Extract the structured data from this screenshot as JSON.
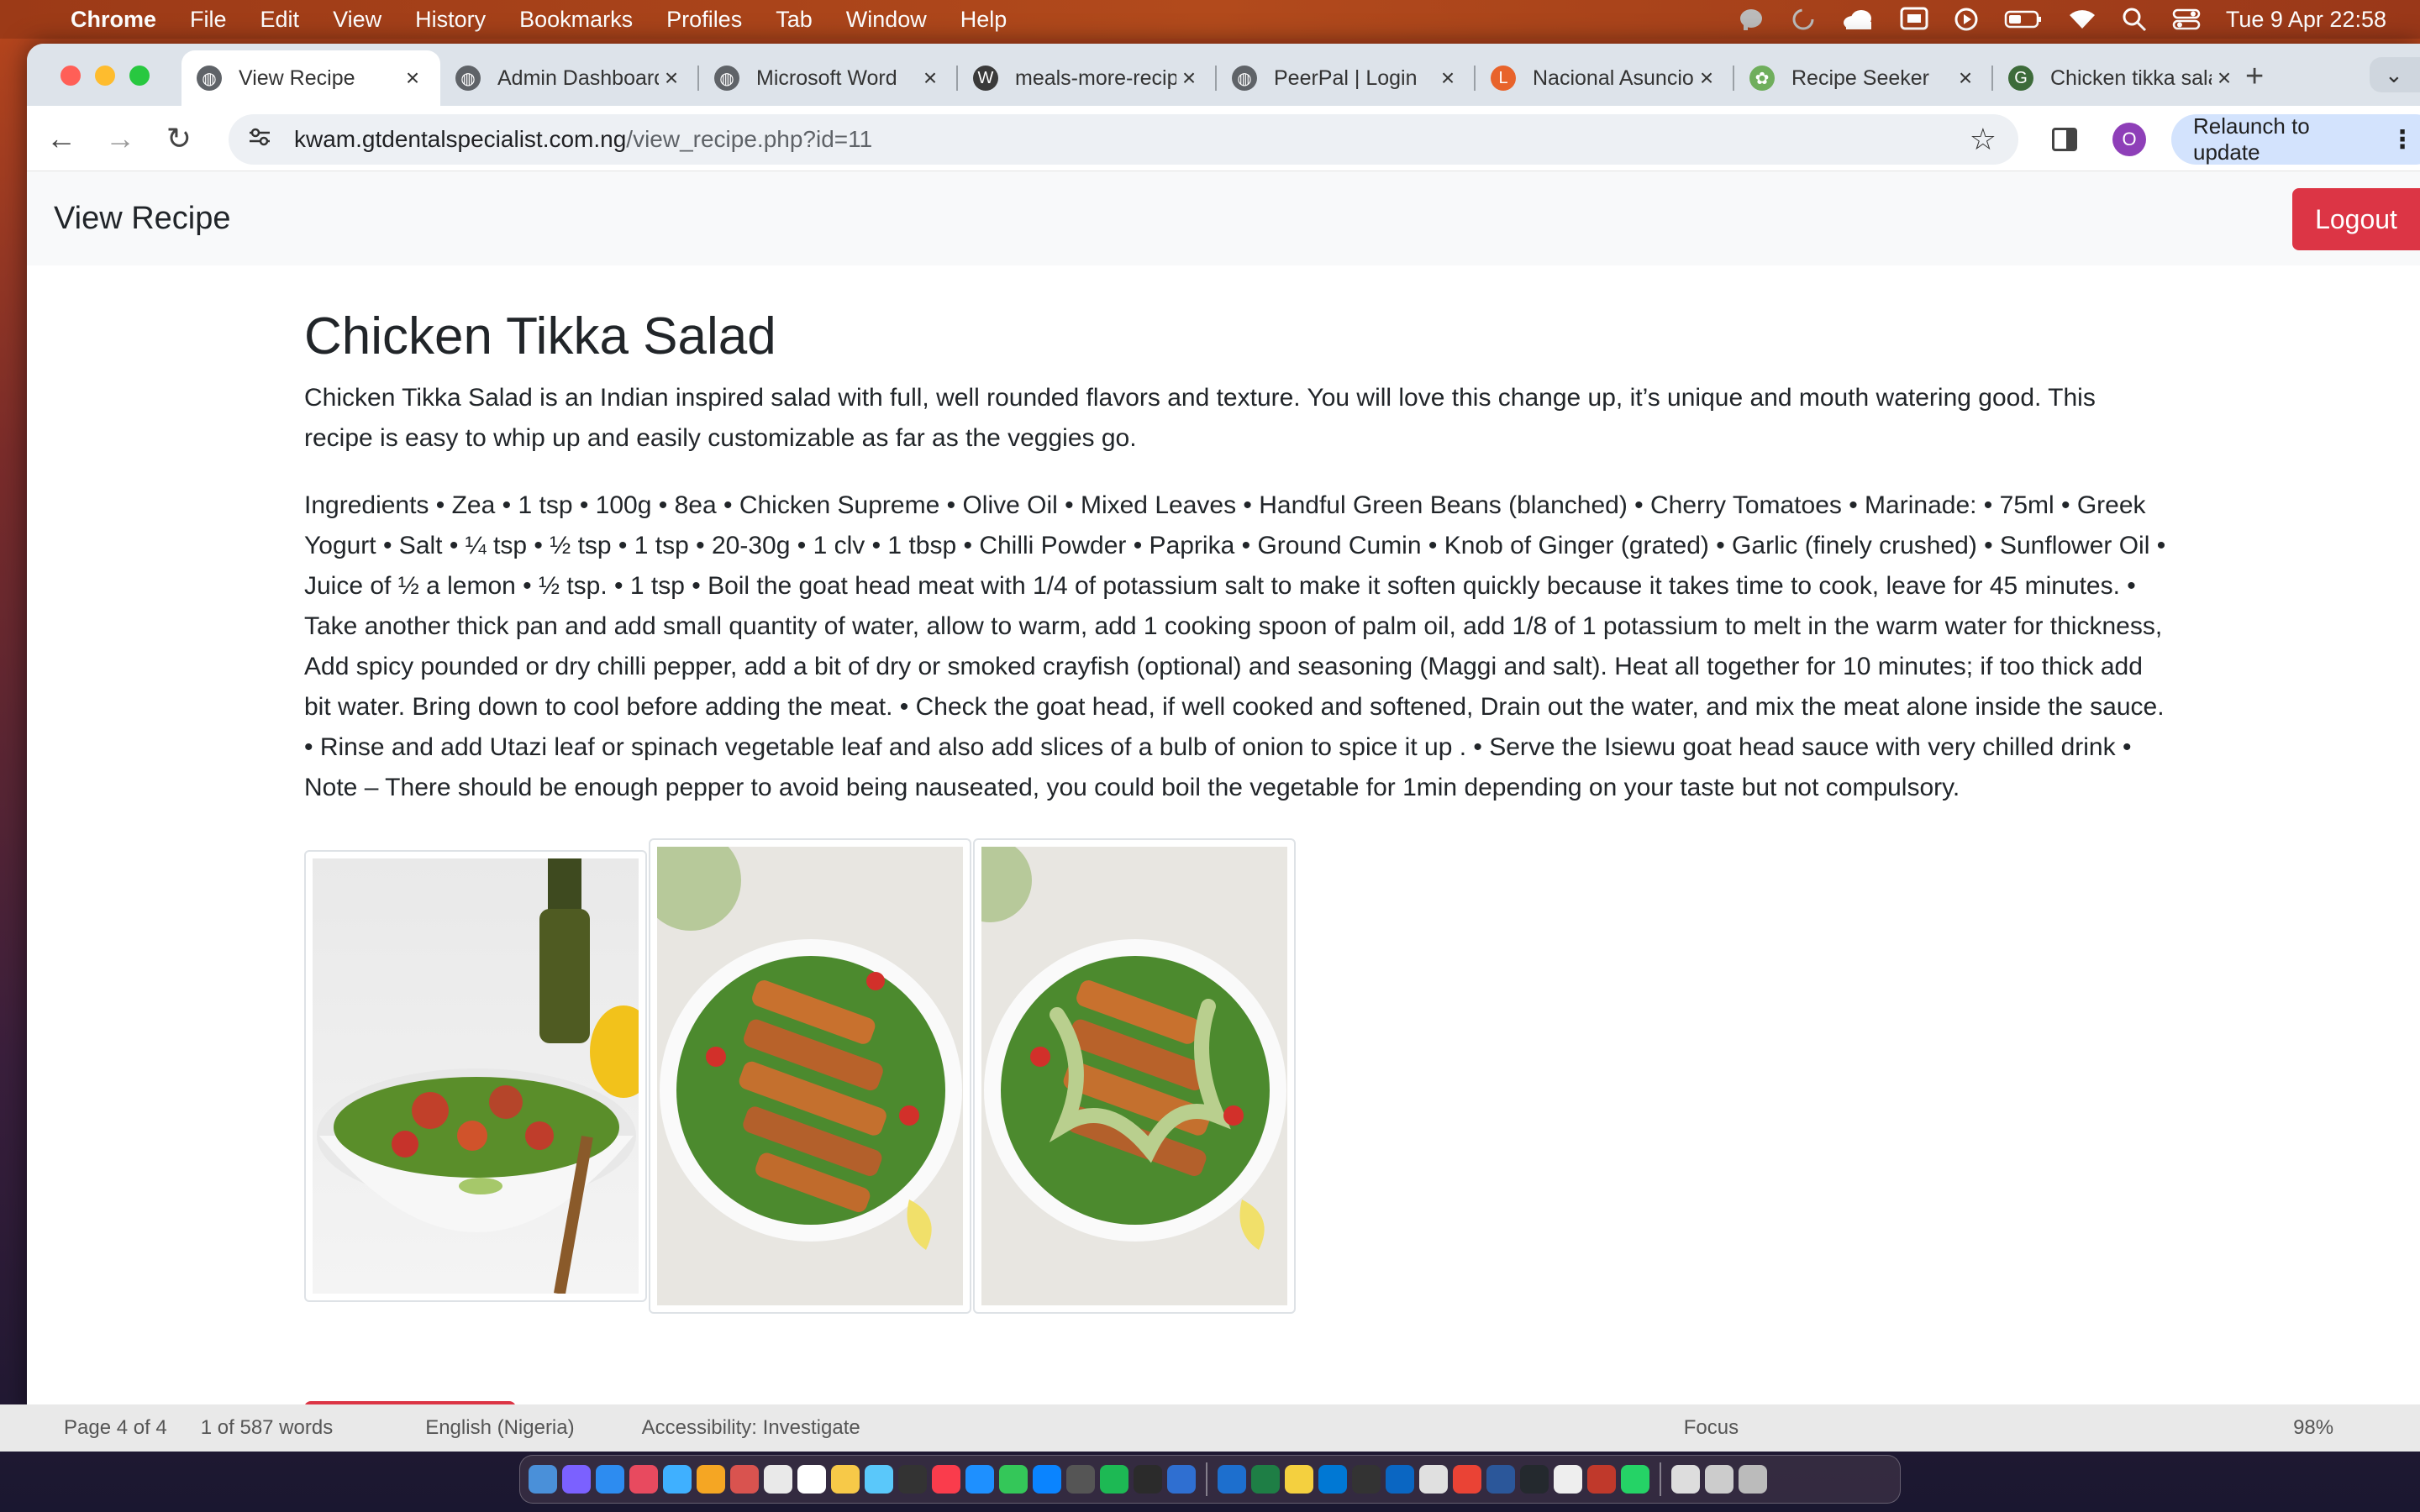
{
  "menubar": {
    "app": "Chrome",
    "items": [
      "File",
      "Edit",
      "View",
      "History",
      "Bookmarks",
      "Profiles",
      "Tab",
      "Window",
      "Help"
    ],
    "clock": "Tue 9 Apr  22:58"
  },
  "tabs": [
    {
      "title": "View Recipe",
      "icon": "globe-icon",
      "active": true
    },
    {
      "title": "Admin Dashboard",
      "icon": "globe-icon"
    },
    {
      "title": "Microsoft Word",
      "icon": "globe-icon"
    },
    {
      "title": "meals-more-recipes",
      "icon": "wordpress-icon"
    },
    {
      "title": "PeerPal | Login",
      "icon": "globe-icon"
    },
    {
      "title": "Nacional Asuncion",
      "icon": "ls-icon"
    },
    {
      "title": "Recipe Seeker",
      "icon": "salad-icon"
    },
    {
      "title": "Chicken tikka salad",
      "icon": "gf-icon"
    }
  ],
  "address": {
    "domain": "kwam.gtdentalspecialist.com.ng",
    "path": "/view_recipe.php?id=11"
  },
  "relaunch_label": "Relaunch to update",
  "avatar_initial": "O",
  "page": {
    "brand": "View Recipe",
    "logout_label": "Logout",
    "title": "Chicken Tikka Salad",
    "description": "Chicken Tikka Salad is an Indian inspired salad with full, well rounded flavors and texture. You will love this change up, it’s unique and mouth watering good. This recipe is easy to whip up and easily customizable as far as the veggies go.",
    "ingredients": "Ingredients • Zea • 1 tsp • 100g • 8ea • Chicken Supreme • Olive Oil • Mixed Leaves • Handful Green Beans (blanched) • Cherry Tomatoes • Marinade: • 75ml • Greek Yogurt • Salt • ¼ tsp • ½ tsp • 1 tsp • 20-30g • 1 clv • 1 tbsp • Chilli Powder • Paprika • Ground Cumin • Knob of Ginger (grated) • Garlic (finely crushed) • Sunflower Oil • Juice of ½ a lemon • ½ tsp. • 1 tsp • Boil the goat head meat with 1/4 of potassium salt to make it soften quickly because it takes time to cook, leave for 45 minutes. • Take another thick pan and add small quantity of water, allow to warm, add 1 cooking spoon of palm oil, add 1/8 of 1 potassium to melt in the warm water for thickness, Add spicy pounded or dry chilli pepper, add a bit of dry or smoked crayfish (optional) and seasoning (Maggi and salt). Heat all together for 10 minutes; if too thick add bit water. Bring down to cool before adding the meat. • Check the goat head, if well cooked and softened, Drain out the water, and mix the meat alone inside the sauce. • Rinse and add Utazi leaf or spinach vegetable leaf and also add slices of a bulb of onion to spice it up . • Serve the Isiewu goat head sauce with very chilled drink • Note – There should be enough pepper to avoid being nauseated, you could boil the vegetable for 1min depending on your taste but not compulsory."
  },
  "wordbar": {
    "page": "Page 4 of 4",
    "words": "1 of 587 words",
    "lang": "English (Nigeria)",
    "access": "Accessibility: Investigate",
    "focus": "Focus",
    "zoom": "98%"
  },
  "colors": {
    "danger": "#dc3545",
    "navbg": "#f8f9fa"
  }
}
